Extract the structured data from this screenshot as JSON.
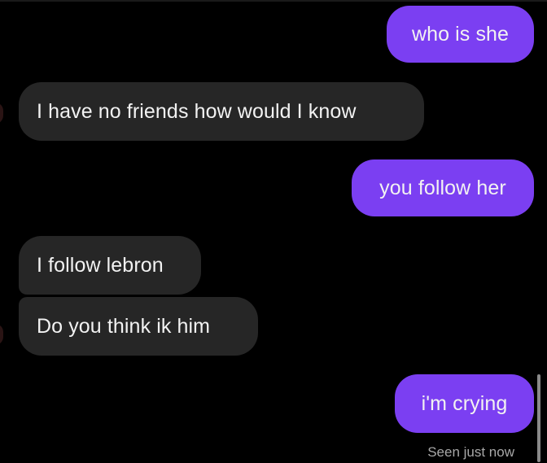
{
  "messages": [
    {
      "direction": "sent",
      "text": "who is she"
    },
    {
      "direction": "received",
      "text": "I have no friends how would I know"
    },
    {
      "direction": "sent",
      "text": "you follow her"
    },
    {
      "direction": "received",
      "text": "I follow lebron"
    },
    {
      "direction": "received",
      "text": "Do you think ik him"
    },
    {
      "direction": "sent",
      "text": "i'm crying"
    }
  ],
  "read_receipt": "Seen just now",
  "colors": {
    "background": "#000000",
    "sent_bubble": "#7b3ff2",
    "received_bubble": "#262626",
    "text": "#f2f2f2",
    "receipt_text": "#a8a8a8"
  }
}
